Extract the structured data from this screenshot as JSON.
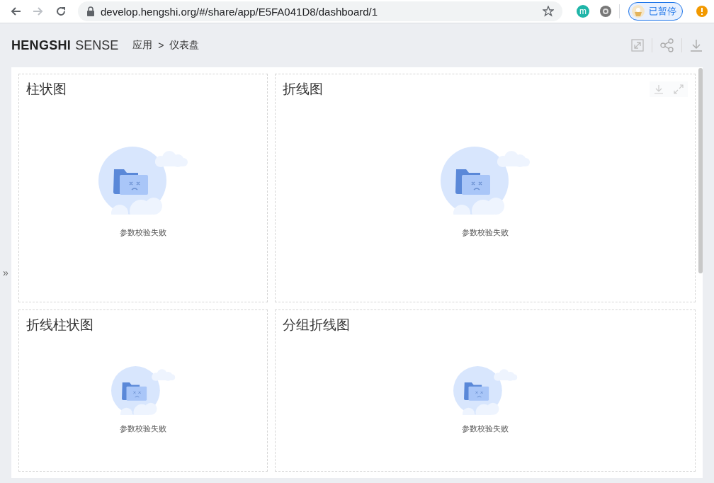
{
  "browser": {
    "url": "develop.hengshi.org/#/share/app/E5FA041D8/dashboard/1",
    "extension_letter": "m",
    "profile_label": "已暂停"
  },
  "app_header": {
    "brand_bold": "HENGSHI",
    "brand_light": "SENSE",
    "breadcrumb": [
      "应用",
      "仪表盘"
    ],
    "breadcrumb_separator": ">"
  },
  "sidebar_toggle": "»",
  "charts": [
    {
      "title": "柱状图",
      "message": "参数校验失败",
      "toolbar_visible": false
    },
    {
      "title": "折线图",
      "message": "参数校验失败",
      "toolbar_visible": true
    },
    {
      "title": "折线柱状图",
      "message": "参数校验失败",
      "toolbar_visible": false
    },
    {
      "title": "分组折线图",
      "message": "参数校验失败",
      "toolbar_visible": false
    }
  ]
}
